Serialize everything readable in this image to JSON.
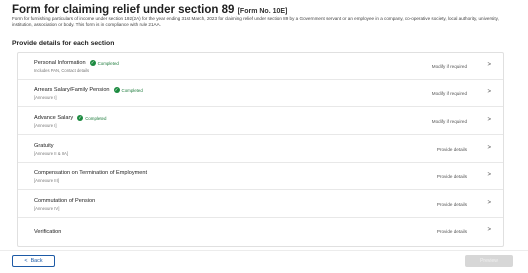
{
  "header": {
    "title": "Form for claiming relief under section 89",
    "form_no": "[Form No. 10E]",
    "description": "Form for furnishing particulars of income under section 192(2A) for the year ending 31st March, 2023 for claiming relief under section 89 by a Government servant or an employee in a company, co-operative society, local authority, university, institution, association or body. This form is in compliance with rule 21AA."
  },
  "section_heading": "Provide details for each section",
  "rows": [
    {
      "name": "Personal Information",
      "sub": "Includes PAN, Contact details",
      "status": "Completed",
      "action": "Modify if required"
    },
    {
      "name": "Arrears Salary/Family Pension",
      "sub": "[Annexure I]",
      "status": "Completed",
      "action": "Modify if required"
    },
    {
      "name": "Advance Salary",
      "sub": "[Annexure I]",
      "status": "Completed",
      "action": "Modify if required"
    },
    {
      "name": "Gratuity",
      "sub": "[Annexure II & IIA]",
      "status": "",
      "action": "Provide details"
    },
    {
      "name": "Compensation on Termination of Employment",
      "sub": "[Annexure III]",
      "status": "",
      "action": "Provide details"
    },
    {
      "name": "Commutation of Pension",
      "sub": "[Annexure IV]",
      "status": "",
      "action": "Provide details"
    },
    {
      "name": "Verification",
      "sub": "",
      "status": "",
      "action": "Provide details"
    }
  ],
  "footer": {
    "back_label": "Back",
    "preview_label": "Preview"
  }
}
